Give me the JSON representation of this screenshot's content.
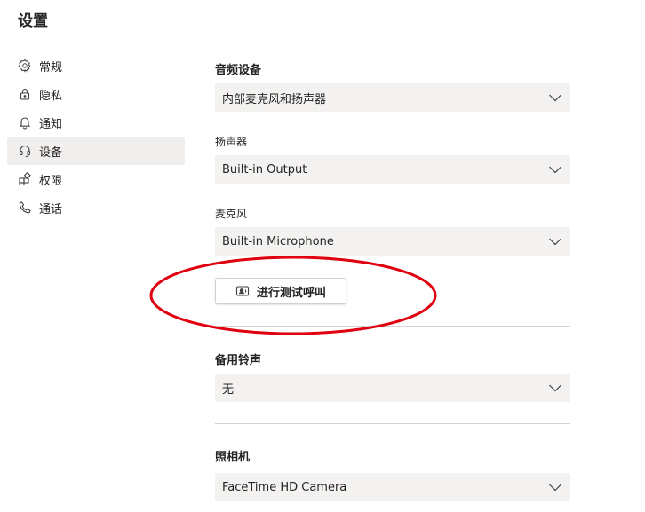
{
  "page": {
    "title": "设置"
  },
  "sidebar": {
    "items": [
      {
        "label": "常规",
        "icon": "gear-icon"
      },
      {
        "label": "隐私",
        "icon": "lock-icon"
      },
      {
        "label": "通知",
        "icon": "bell-icon"
      },
      {
        "label": "设备",
        "icon": "headset-icon",
        "active": true
      },
      {
        "label": "权限",
        "icon": "apps-icon"
      },
      {
        "label": "通话",
        "icon": "phone-icon"
      }
    ]
  },
  "audio": {
    "section_title": "音频设备",
    "audio_device_value": "内部麦克风和扬声器",
    "speaker_label": "扬声器",
    "speaker_value": "Built-in Output",
    "mic_label": "麦克风",
    "mic_value": "Built-in Microphone",
    "test_call_label": "进行测试呼叫"
  },
  "ringer": {
    "section_title": "备用铃声",
    "value": "无"
  },
  "camera": {
    "section_title": "照相机",
    "value": "FaceTime HD Camera"
  },
  "colors": {
    "annotation": "#e0000f",
    "active_bg": "#f1efed",
    "dropdown_bg": "#f3f2f1"
  }
}
